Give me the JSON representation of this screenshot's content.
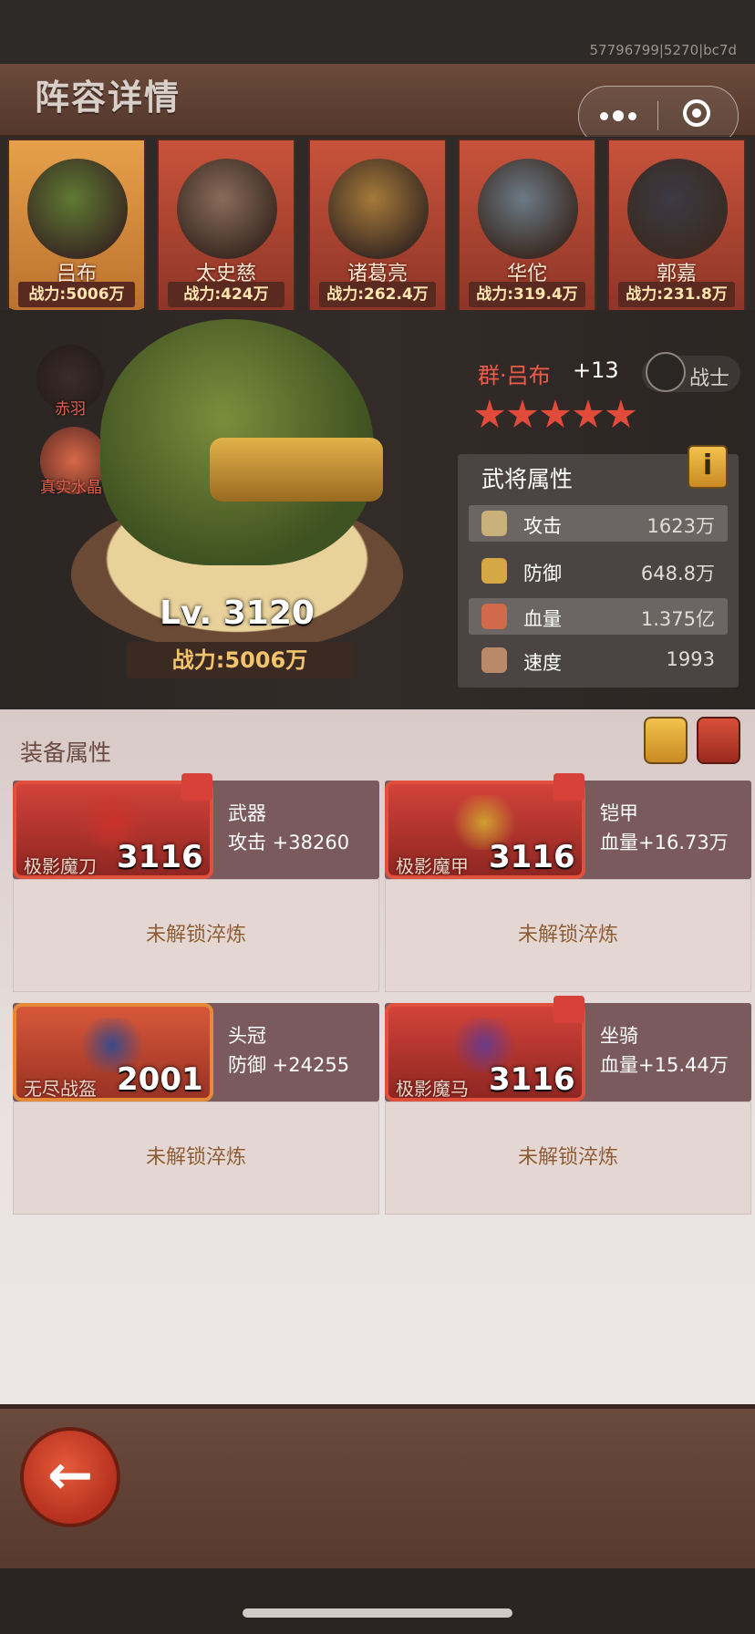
{
  "build_id": "57796799|5270|bc7d",
  "page_title": "阵容详情",
  "heroes": [
    {
      "name": "吕布",
      "power": "战力:5006万",
      "active": true,
      "color": "#5f7a33"
    },
    {
      "name": "太史慈",
      "power": "战力:424万",
      "active": false,
      "color": "#8a6b5a"
    },
    {
      "name": "诸葛亮",
      "power": "战力:262.4万",
      "active": false,
      "color": "#a67a3a"
    },
    {
      "name": "华佗",
      "power": "战力:319.4万",
      "active": false,
      "color": "#6c7a86"
    },
    {
      "name": "郭嘉",
      "power": "战力:231.8万",
      "active": false,
      "color": "#3c3a44"
    }
  ],
  "skills": [
    {
      "label": "赤羽",
      "icon": "red-feather-icon"
    },
    {
      "label": "真实水晶",
      "icon": "crystal-icon"
    }
  ],
  "hero": {
    "title": "群·吕布",
    "plus": "+13",
    "class": "战士",
    "stars": 5,
    "level": "Lv. 3120",
    "power": "战力:5006万"
  },
  "attributes": {
    "title": "武将属性",
    "info_label": "i",
    "rows": [
      {
        "name": "攻击",
        "value": "1623万",
        "icon": "sword-icon",
        "highlight": true
      },
      {
        "name": "防御",
        "value": "648.8万",
        "icon": "shield-icon",
        "highlight": false
      },
      {
        "name": "血量",
        "value": "1.375亿",
        "icon": "hp-crystal-icon",
        "highlight": true
      },
      {
        "name": "速度",
        "value": "1993",
        "icon": "boot-icon",
        "highlight": false
      }
    ]
  },
  "equipment": {
    "title": "装备属性",
    "items": [
      {
        "name": "极影魔刀",
        "level": "3116",
        "type": "武器",
        "stat": "攻击  +38260",
        "lock": "未解锁淬炼",
        "frame": "red",
        "color": "#c9322a"
      },
      {
        "name": "极影魔甲",
        "level": "3116",
        "type": "铠甲",
        "stat": "血量+16.73万",
        "lock": "未解锁淬炼",
        "frame": "red",
        "color": "#d0a030"
      },
      {
        "name": "无尽战盔",
        "level": "2001",
        "type": "头冠",
        "stat": "防御  +24255",
        "lock": "未解锁淬炼",
        "frame": "orange",
        "color": "#3a4a8a"
      },
      {
        "name": "极影魔马",
        "level": "3116",
        "type": "坐骑",
        "stat": "血量+15.44万",
        "lock": "未解锁淬炼",
        "frame": "red",
        "color": "#6a3a8a"
      }
    ]
  },
  "back_label": "←"
}
